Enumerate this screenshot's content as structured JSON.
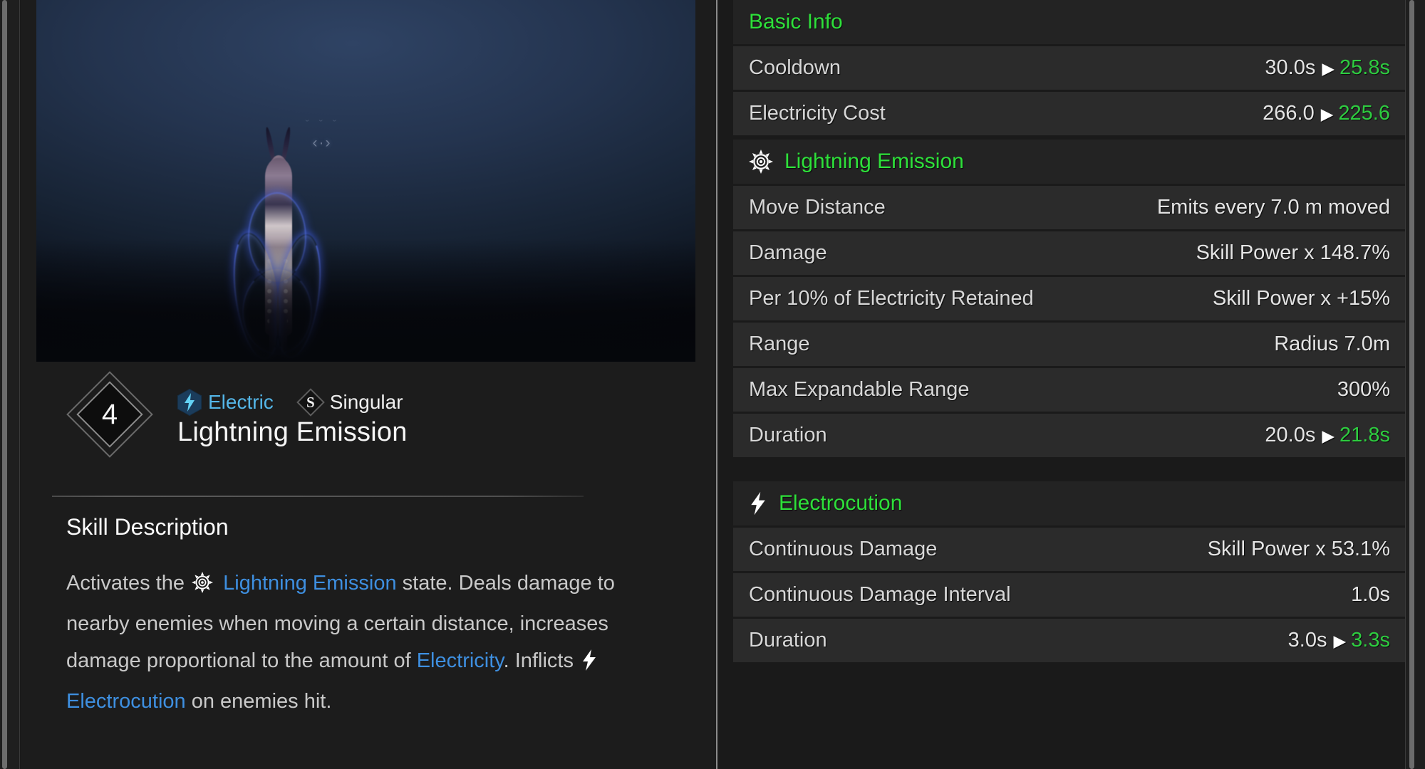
{
  "colors": {
    "accent_green": "#2ee03a",
    "link_blue": "#3e8fe0",
    "electric_blue": "#54b6e8",
    "row_bg": "#2b2b2b",
    "panel_bg": "#1a1a1a"
  },
  "preview": {
    "rotate_hint": "‹·›",
    "rotate_hint_arcs": "˘ ˘ ˘"
  },
  "skill": {
    "rank": "4",
    "name": "Lightning Emission",
    "tags": [
      {
        "label": "Electric",
        "icon": "lightning-hex-icon"
      },
      {
        "label": "Singular",
        "icon": "singular-diamond-icon"
      }
    ],
    "description_heading": "Skill Description",
    "description": {
      "part1": "Activates the",
      "kw1": "Lightning Emission",
      "part2": "state. Deals damage to nearby enemies when moving a certain distance, increases damage proportional to the amount of",
      "kw2": "Electricity",
      "part3": ". Inflicts",
      "kw3": "Electrocution",
      "part4": "on enemies hit."
    }
  },
  "stats": {
    "sections": [
      {
        "title": "Basic Info",
        "icon": null,
        "rows": [
          {
            "label": "Cooldown",
            "base": "30.0s",
            "arrow": "▶",
            "buffed": "25.8s"
          },
          {
            "label": "Electricity Cost",
            "base": "266.0",
            "arrow": "▶",
            "buffed": "225.6"
          }
        ]
      },
      {
        "title": "Lightning Emission",
        "icon": "lightning-emission-sunburst-icon",
        "rows": [
          {
            "label": "Move Distance",
            "base": "Emits every 7.0 m moved",
            "arrow": "",
            "buffed": ""
          },
          {
            "label": "Damage",
            "base": "Skill Power x 148.7%",
            "arrow": "",
            "buffed": ""
          },
          {
            "label": "Per 10% of Electricity Retained",
            "base": "Skill Power x +15%",
            "arrow": "",
            "buffed": ""
          },
          {
            "label": "Range",
            "base": "Radius 7.0m",
            "arrow": "",
            "buffed": ""
          },
          {
            "label": "Max Expandable Range",
            "base": "300%",
            "arrow": "",
            "buffed": ""
          },
          {
            "label": "Duration",
            "base": "20.0s",
            "arrow": "▶",
            "buffed": "21.8s"
          }
        ]
      },
      {
        "title": "Electrocution",
        "icon": "lightning-bolt-icon",
        "rows": [
          {
            "label": "Continuous Damage",
            "base": "Skill Power x 53.1%",
            "arrow": "",
            "buffed": ""
          },
          {
            "label": "Continuous Damage Interval",
            "base": "1.0s",
            "arrow": "",
            "buffed": ""
          },
          {
            "label": "Duration",
            "base": "3.0s",
            "arrow": "▶",
            "buffed": "3.3s"
          }
        ]
      }
    ]
  }
}
